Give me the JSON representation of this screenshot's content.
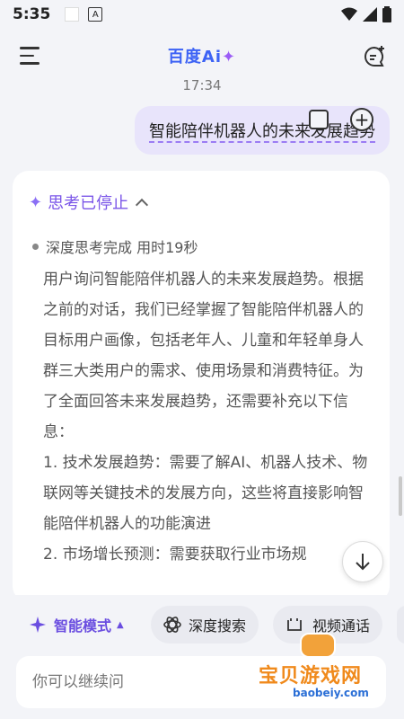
{
  "status_bar": {
    "time": "5:35",
    "notification_letter": "A"
  },
  "header": {
    "brand": "百度Ai",
    "brand_spark": "✦"
  },
  "conversation": {
    "timestamp": "17:34",
    "user_message": "智能陪伴机器人的未来发展趋势",
    "thinking": {
      "label": "思考已停止",
      "status": "深度思考完成 用时19秒",
      "paragraphs": [
        "用户询问智能陪伴机器人的未来发展趋势。根据之前的对话，我们已经掌握了智能陪伴机器人的目标用户画像，包括老年人、儿童和年轻单身人群三大类用户的需求、使用场景和消费特征。为了全面回答未来发展趋势，还需要补充以下信息：",
        "1. 技术发展趋势：需要了解AI、机器人技术、物联网等关键技术的发展方向，这些将直接影响智能陪伴机器人的功能演进",
        "2. 市场增长预测：需要获取行业市场规"
      ]
    }
  },
  "toolbar": {
    "mode_label": "智能模式",
    "deep_search_label": "深度搜索",
    "video_call_label": "视频通话"
  },
  "input": {
    "placeholder": "你可以继续问"
  },
  "watermark": {
    "text": "宝贝游戏网",
    "url": "baobeiy.com"
  },
  "colors": {
    "accent": "#7a55e8",
    "brand": "#3d63f5",
    "bubble": "#e8e4fb"
  }
}
